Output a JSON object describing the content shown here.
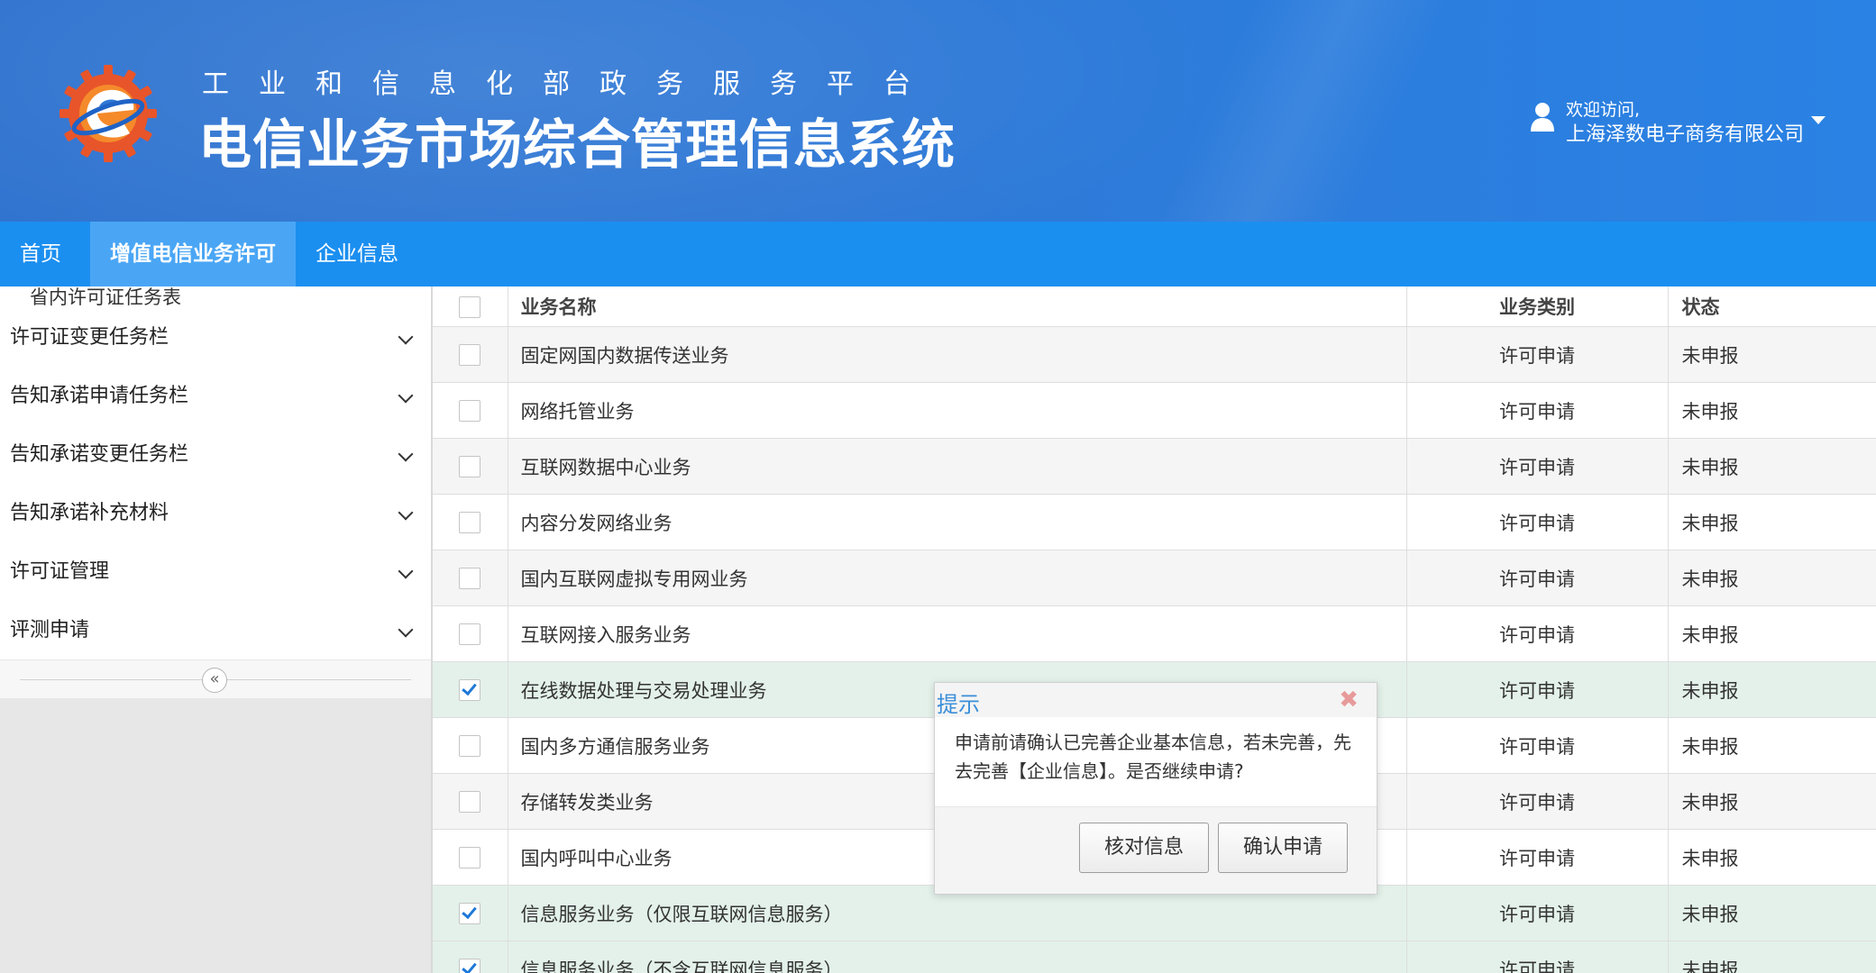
{
  "header": {
    "platform_title": "工业和信息化部政务服务平台",
    "system_title": "电信业务市场综合管理信息系统",
    "welcome": "欢迎访问,",
    "company": "上海泽数电子商务有限公司"
  },
  "nav": {
    "items": [
      {
        "label": "首页"
      },
      {
        "label": "增值电信业务许可"
      },
      {
        "label": "企业信息"
      }
    ],
    "active_index": 1
  },
  "sidebar": {
    "top_item": "省内许可证任务表",
    "items": [
      {
        "label": "许可证变更任务栏"
      },
      {
        "label": "告知承诺申请任务栏"
      },
      {
        "label": "告知承诺变更任务栏"
      },
      {
        "label": "告知承诺补充材料"
      },
      {
        "label": "许可证管理"
      },
      {
        "label": "评测申请"
      }
    ],
    "collapse_glyph": "«"
  },
  "table": {
    "headers": {
      "name": "业务名称",
      "type": "业务类别",
      "status": "状态"
    },
    "rows": [
      {
        "name": "固定网国内数据传送业务",
        "type": "许可申请",
        "status": "未申报",
        "checked": false
      },
      {
        "name": "网络托管业务",
        "type": "许可申请",
        "status": "未申报",
        "checked": false
      },
      {
        "name": "互联网数据中心业务",
        "type": "许可申请",
        "status": "未申报",
        "checked": false
      },
      {
        "name": "内容分发网络业务",
        "type": "许可申请",
        "status": "未申报",
        "checked": false
      },
      {
        "name": "国内互联网虚拟专用网业务",
        "type": "许可申请",
        "status": "未申报",
        "checked": false
      },
      {
        "name": "互联网接入服务业务",
        "type": "许可申请",
        "status": "未申报",
        "checked": false
      },
      {
        "name": "在线数据处理与交易处理业务",
        "type": "许可申请",
        "status": "未申报",
        "checked": true
      },
      {
        "name": "国内多方通信服务业务",
        "type": "许可申请",
        "status": "未申报",
        "checked": false
      },
      {
        "name": "存储转发类业务",
        "type": "许可申请",
        "status": "未申报",
        "checked": false
      },
      {
        "name": "国内呼叫中心业务",
        "type": "许可申请",
        "status": "未申报",
        "checked": false
      },
      {
        "name": "信息服务业务（仅限互联网信息服务）",
        "type": "许可申请",
        "status": "未申报",
        "checked": true
      },
      {
        "name": "信息服务业务（不含互联网信息服务）",
        "type": "许可申请",
        "status": "未申报",
        "checked": true
      }
    ]
  },
  "dialog": {
    "title": "提示",
    "close_glyph": "✖",
    "message": "申请前请确认已完善企业基本信息，若未完善，先去完善【企业信息】。是否继续申请?",
    "verify_label": "核对信息",
    "confirm_label": "确认申请"
  },
  "colors": {
    "header_blue": "#2e78d6",
    "nav_blue": "#1b8ff0",
    "nav_active": "#4aa6f5",
    "selected_row": "#e3f1ea",
    "check_blue": "#1e78d8",
    "dialog_title": "#3a8ed8"
  }
}
